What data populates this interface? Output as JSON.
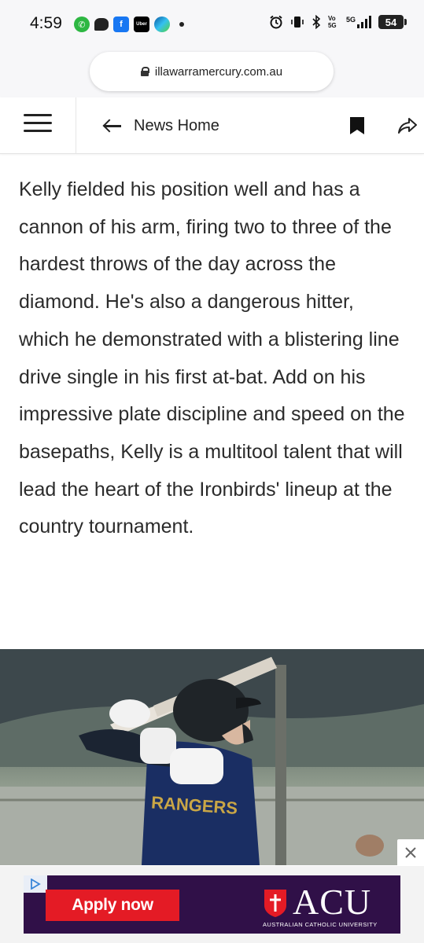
{
  "status_bar": {
    "time": "4:59",
    "battery": "54",
    "network": "5G",
    "volte": "Vo 5G"
  },
  "browser": {
    "url": "illawarramercury.com.au"
  },
  "site_nav": {
    "back_label": "News Home"
  },
  "article": {
    "paragraph": "Kelly fielded his position well and has a cannon of his arm, firing two to three of the hardest throws of the day across the diamond. He's also a dangerous hitter, which he demonstrated with a blistering line drive single in his first at-bat. Add on his impressive plate discipline and speed on the basepaths, Kelly is a multitool talent that will lead the heart of the Ironbirds' lineup at the country tournament."
  },
  "photo": {
    "jersey_text": "RANGERS"
  },
  "ad": {
    "button_label": "Apply now",
    "brand": "ACU",
    "brand_full": "AUSTRALIAN CATHOLIC UNIVERSITY",
    "colors": {
      "background": "#301048",
      "button": "#e41b25"
    }
  }
}
